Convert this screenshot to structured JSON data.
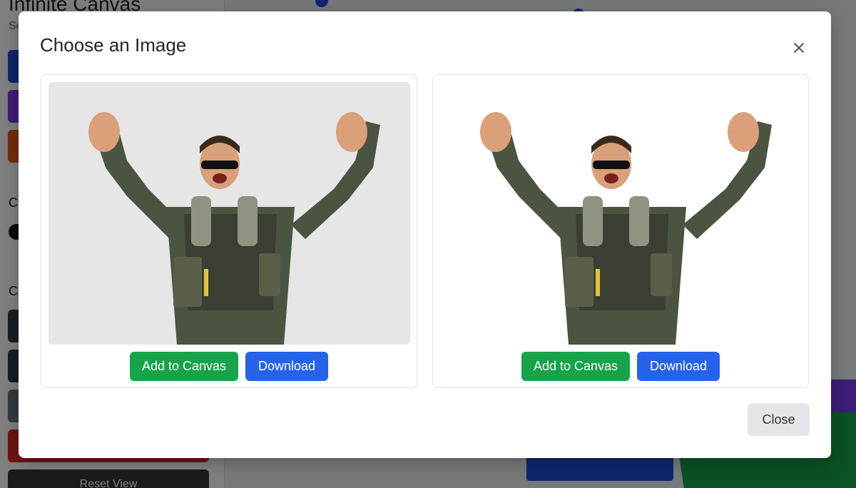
{
  "background": {
    "app_title": "Infinite Canvas",
    "app_subtitle": "Se",
    "sidebar_labels": [
      "C",
      "C"
    ],
    "reset_label": "Reset View",
    "colors": {
      "blue": "#1d4ed8",
      "purple": "#7c3aed",
      "orange": "#ea580c",
      "dark": "#343a40",
      "red": "#dc2626",
      "green": "#16a34a"
    }
  },
  "modal": {
    "title": "Choose an Image",
    "close_icon": "close-icon",
    "cards": [
      {
        "image_alt": "man-arms-raised-gray-bg",
        "add_label": "Add to Canvas",
        "download_label": "Download"
      },
      {
        "image_alt": "man-arms-raised-white-bg",
        "add_label": "Add to Canvas",
        "download_label": "Download"
      }
    ],
    "footer_close_label": "Close"
  }
}
